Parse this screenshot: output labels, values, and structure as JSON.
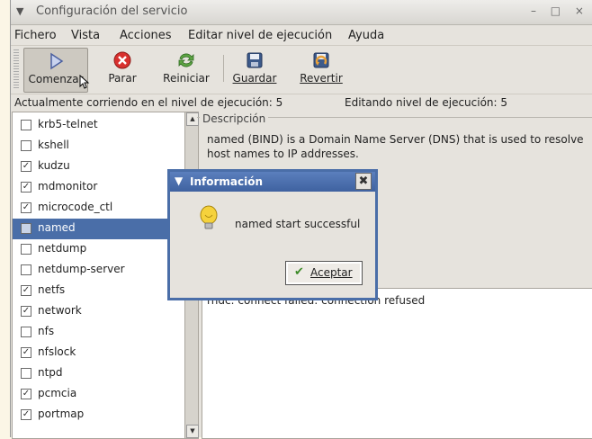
{
  "window": {
    "title": "Configuración del servicio",
    "menu_glyph": "▼",
    "buttons": "– □ ×"
  },
  "menubar": {
    "items": [
      "Fichero",
      "Vista",
      "Acciones",
      "Editar nivel de ejecución",
      "Ayuda"
    ]
  },
  "toolbar": {
    "start": "Comenzar",
    "stop": "Parar",
    "restart": "Reiniciar",
    "save": "Guardar",
    "revert": "Revertir"
  },
  "status": {
    "current": "Actualmente corriendo en el nivel de ejecución: 5",
    "editing": "Editando nivel de ejecución: 5"
  },
  "services": [
    {
      "name": "krb5-telnet",
      "checked": false,
      "selected": false
    },
    {
      "name": "kshell",
      "checked": false,
      "selected": false
    },
    {
      "name": "kudzu",
      "checked": true,
      "selected": false
    },
    {
      "name": "mdmonitor",
      "checked": true,
      "selected": false
    },
    {
      "name": "microcode_ctl",
      "checked": true,
      "selected": false
    },
    {
      "name": "named",
      "checked": false,
      "selected": true
    },
    {
      "name": "netdump",
      "checked": false,
      "selected": false
    },
    {
      "name": "netdump-server",
      "checked": false,
      "selected": false
    },
    {
      "name": "netfs",
      "checked": true,
      "selected": false
    },
    {
      "name": "network",
      "checked": true,
      "selected": false
    },
    {
      "name": "nfs",
      "checked": false,
      "selected": false
    },
    {
      "name": "nfslock",
      "checked": true,
      "selected": false
    },
    {
      "name": "ntpd",
      "checked": false,
      "selected": false
    },
    {
      "name": "pcmcia",
      "checked": true,
      "selected": false
    },
    {
      "name": "portmap",
      "checked": true,
      "selected": false
    }
  ],
  "description": {
    "label": "Descripción",
    "text": "named (BIND) is a Domain Name Server (DNS) that is used to resolve host names to IP addresses."
  },
  "output": {
    "text": "rndc: connect failed: connection refused"
  },
  "dialog": {
    "title": "Información",
    "message": "named start successful",
    "ok_label": "Aceptar"
  },
  "colors": {
    "selection": "#4a6ea8",
    "dialog_title": "#4a6ea8",
    "background": "#e6e3dd"
  }
}
